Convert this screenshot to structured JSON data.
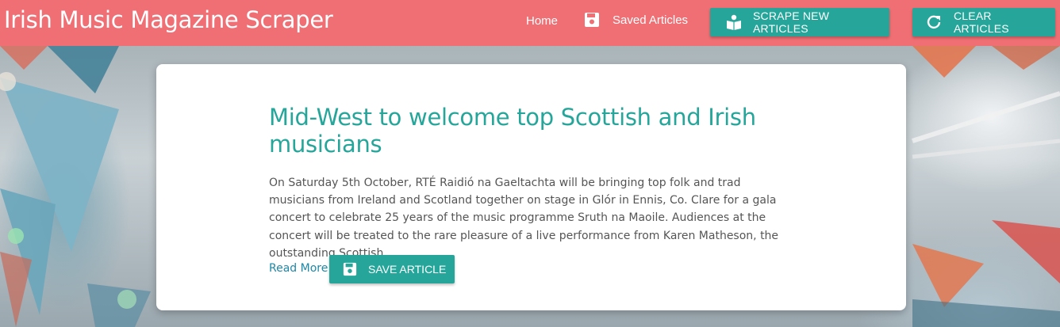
{
  "header": {
    "brand": "Irish Music Magazine Scraper",
    "nav": {
      "home_label": "Home",
      "saved_label": "Saved Articles",
      "scrape_label": "SCRAPE NEW ARTICLES",
      "clear_label": "CLEAR ARTICLES"
    },
    "icons": {
      "saved": "floppy-disk-icon",
      "scrape": "book-reader-icon",
      "clear": "refresh-icon"
    }
  },
  "article": {
    "title": "Mid-West to welcome top Scottish and Irish musicians",
    "summary": "On Saturday 5th October, RTÉ Raidió na Gaeltachta will be bringing top folk and trad musicians from Ireland and Scotland together on stage in Glór in Ennis, Co. Clare for a gala concert to celebrate 25 years of the music programme Sruth na Maoile. Audiences at the concert will be treated to the rare pleasure of a live performance from Karen Matheson, the outstanding Scottish…",
    "read_more_label": "Read More",
    "save_label": "SAVE ARTICLE",
    "save_icon": "floppy-disk-icon"
  },
  "colors": {
    "header": "#ef6f74",
    "accent": "#26a69a",
    "link": "#1e88a8",
    "body_text": "#555555"
  }
}
